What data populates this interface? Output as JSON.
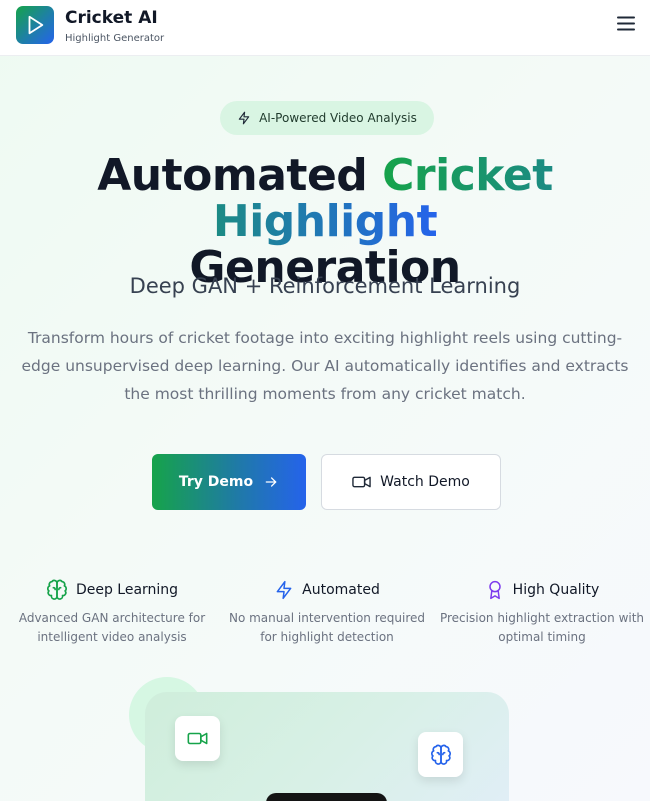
{
  "header": {
    "brand_title": "Cricket AI",
    "brand_subtitle": "Highlight Generator",
    "logo_icon": "play-icon",
    "menu_icon": "hamburger-menu-icon"
  },
  "hero": {
    "badge_icon": "lightning-icon",
    "badge_text": "AI-Powered Video Analysis",
    "headline_part1": "Automated",
    "headline_highlight": "Cricket Highlight",
    "headline_part2": "Generation",
    "subtitle": "Deep GAN + Reinforcement Learning",
    "description": "Transform hours of cricket footage into exciting highlight reels using cutting-edge unsupervised deep learning. Our AI automatically identifies and extracts the most thrilling moments from any cricket match.",
    "primary_button": {
      "label": "Try Demo",
      "icon": "arrow-right-icon"
    },
    "secondary_button": {
      "label": "Watch Demo",
      "icon": "video-icon"
    }
  },
  "features": [
    {
      "icon": "brain-icon",
      "title": "Deep Learning",
      "description": "Advanced GAN architecture for intelligent video analysis"
    },
    {
      "icon": "lightning-icon",
      "title": "Automated",
      "description": "No manual intervention required for highlight detection"
    },
    {
      "icon": "award-icon",
      "title": "High Quality",
      "description": "Precision highlight extraction with optimal timing"
    }
  ],
  "preview": {
    "tile_left_icon": "video-icon",
    "tile_right_icon": "brain-icon"
  },
  "colors": {
    "green": "#16a34a",
    "blue": "#2563eb",
    "purple": "#7c3aed",
    "badge_bg": "#d9f5e3"
  }
}
